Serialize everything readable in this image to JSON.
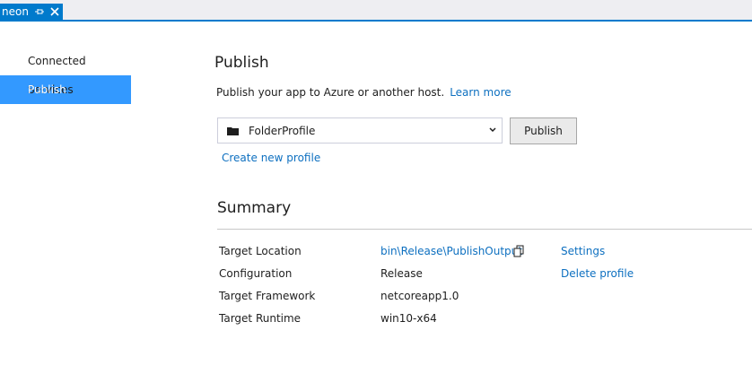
{
  "document_tab": {
    "title": "neon",
    "pin_icon": "pin-icon",
    "close_icon": "close-icon",
    "accent_color": "#007acc"
  },
  "nav": {
    "items": [
      {
        "label": "Connected Services",
        "active": false
      },
      {
        "label": "Publish",
        "active": true
      }
    ],
    "active_color": "#3399ff"
  },
  "publish": {
    "title": "Publish",
    "intro_text": "Publish your app to Azure or another host.",
    "learn_more": "Learn more",
    "profile_select_value": "FolderProfile",
    "profile_icon": "folder-icon",
    "publish_button": "Publish",
    "create_profile_link": "Create new profile"
  },
  "summary": {
    "title": "Summary",
    "rows": [
      {
        "label": "Target Location",
        "value": "bin\\Release\\PublishOutput"
      },
      {
        "label": "Configuration",
        "value": "Release"
      },
      {
        "label": "Target Framework",
        "value": "netcoreapp1.0"
      },
      {
        "label": "Target Runtime",
        "value": "win10-x64"
      }
    ],
    "copy_icon": "copy-icon",
    "settings_link": "Settings",
    "delete_profile_link": "Delete profile",
    "link_color": "#0e70c0"
  }
}
